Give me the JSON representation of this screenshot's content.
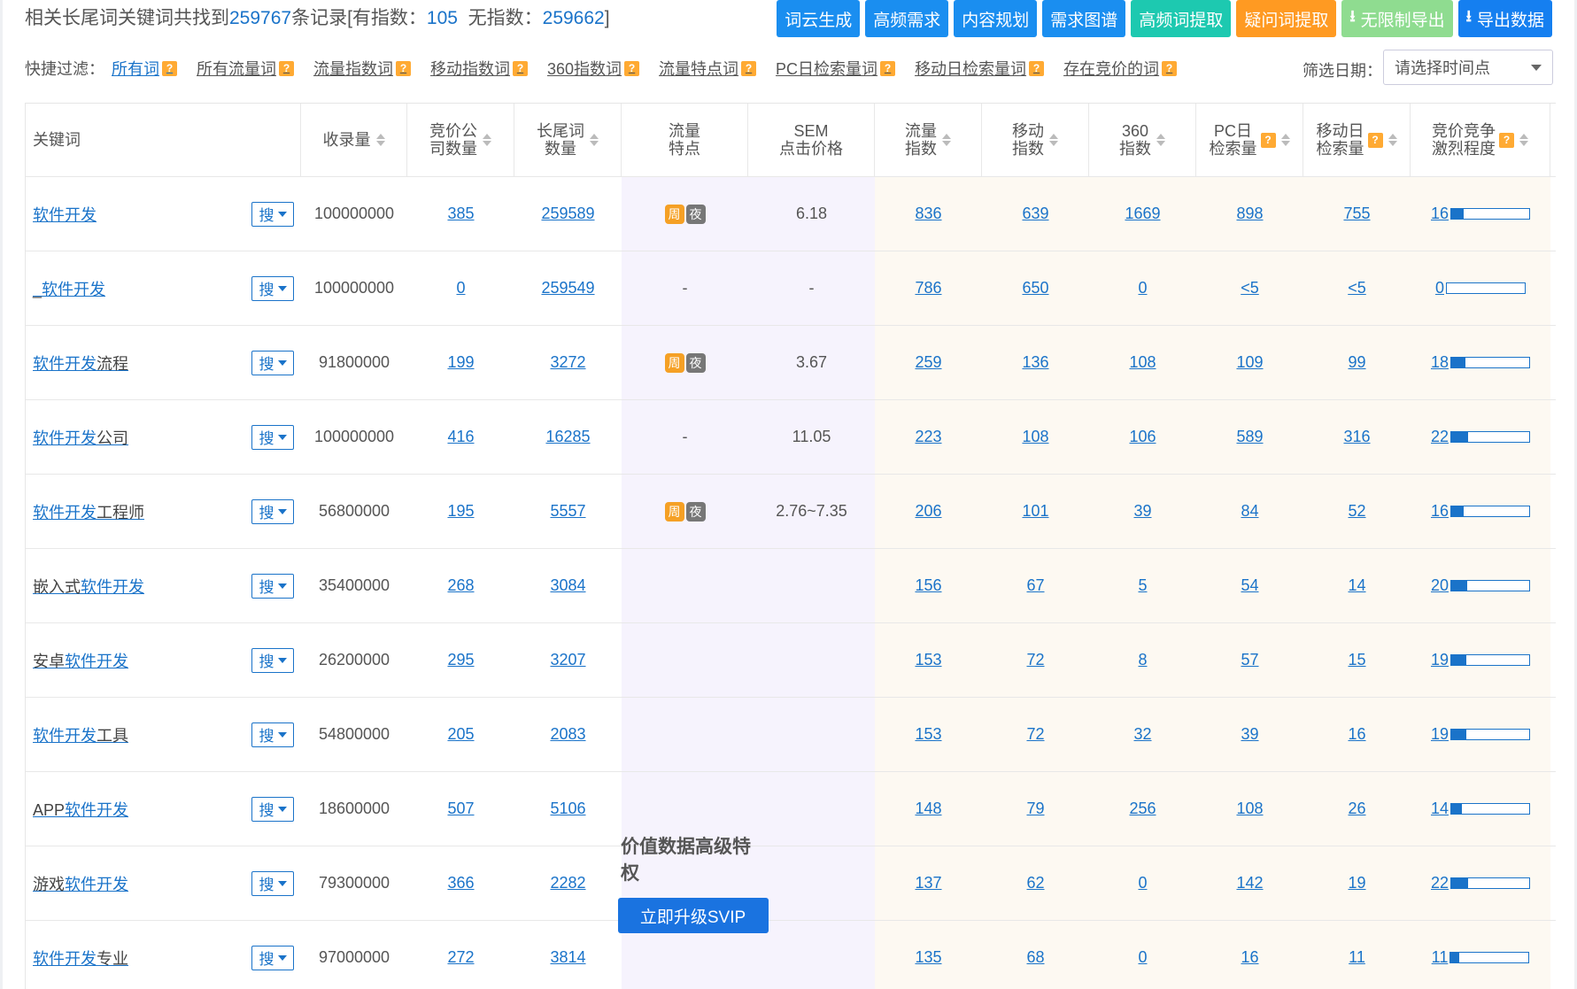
{
  "summary": {
    "prefix": "相关长尾词关键词共找到",
    "total": "259767",
    "mid": "条记录[有指数：",
    "with_index": "105",
    "mid2": "  无指数：",
    "without_index": "259662",
    "suffix": "]"
  },
  "actions": [
    {
      "label": "词云生成",
      "style": "blue"
    },
    {
      "label": "高频需求",
      "style": "blue"
    },
    {
      "label": "内容规划",
      "style": "blue"
    },
    {
      "label": "需求图谱",
      "style": "blue"
    },
    {
      "label": "高频词提取",
      "style": "teal"
    },
    {
      "label": "疑问词提取",
      "style": "orange"
    },
    {
      "label": "无限制导出",
      "style": "lgreen",
      "icon": "download-icon"
    },
    {
      "label": "导出数据",
      "style": "dblue",
      "icon": "download-icon"
    }
  ],
  "filters": {
    "label": "快捷过滤：",
    "items": [
      "所有词",
      "所有流量词",
      "流量指数词",
      "移动指数词",
      "360指数词",
      "流量特点词",
      "PC日检索量词",
      "移动日检索量词",
      "存在竞价的词"
    ],
    "active_index": 0,
    "help_glyph": "?"
  },
  "date_filter": {
    "label": "筛选日期：",
    "placeholder": "请选择时间点"
  },
  "table": {
    "headers": {
      "keyword": "关键词",
      "shoulu": "收录量",
      "bid_companies": [
        "竞价公",
        "司数量"
      ],
      "longtail": [
        "长尾词",
        "数量"
      ],
      "traffic_feature": [
        "流量",
        "特点"
      ],
      "sem": [
        "SEM",
        "点击价格"
      ],
      "traffic_index": [
        "流量",
        "指数"
      ],
      "mobile_index": [
        "移动",
        "指数"
      ],
      "index360": [
        "360",
        "指数"
      ],
      "pc_daily": [
        "PC日",
        "检索量"
      ],
      "mobile_daily": [
        "移动日",
        "检索量"
      ],
      "competition": [
        "竞价竞争",
        "激烈程度"
      ]
    },
    "search_btn": "搜",
    "tag_week": "周",
    "tag_night": "夜",
    "rows": [
      {
        "pre": "",
        "kw": "软件开发",
        "post": "",
        "shoulu": "100000000",
        "bid": "385",
        "lt": "259589",
        "feat": true,
        "feat_text": "",
        "sem": "6.18",
        "ti": "836",
        "mi": "639",
        "i360": "1669",
        "pc": "898",
        "md": "755",
        "comp": "16",
        "comp_pct": 0.16
      },
      {
        "pre": "_",
        "kw": "软件开发",
        "post": "",
        "shoulu": "100000000",
        "bid": "0",
        "lt": "259549",
        "feat": false,
        "feat_text": "-",
        "sem": "-",
        "ti": "786",
        "mi": "650",
        "i360": "0",
        "pc": "<5",
        "md": "<5",
        "comp": "0",
        "comp_pct": 0.0
      },
      {
        "pre": "",
        "kw": "软件开发",
        "post": "流程",
        "shoulu": "91800000",
        "bid": "199",
        "lt": "3272",
        "feat": true,
        "feat_text": "",
        "sem": "3.67",
        "ti": "259",
        "mi": "136",
        "i360": "108",
        "pc": "109",
        "md": "99",
        "comp": "18",
        "comp_pct": 0.18
      },
      {
        "pre": "",
        "kw": "软件开发",
        "post": "公司",
        "shoulu": "100000000",
        "bid": "416",
        "lt": "16285",
        "feat": false,
        "feat_text": "-",
        "sem": "11.05",
        "ti": "223",
        "mi": "108",
        "i360": "106",
        "pc": "589",
        "md": "316",
        "comp": "22",
        "comp_pct": 0.22
      },
      {
        "pre": "",
        "kw": "软件开发",
        "post": "工程师",
        "shoulu": "56800000",
        "bid": "195",
        "lt": "5557",
        "feat": true,
        "feat_text": "",
        "sem": "2.76~7.35",
        "ti": "206",
        "mi": "101",
        "i360": "39",
        "pc": "84",
        "md": "52",
        "comp": "16",
        "comp_pct": 0.16
      },
      {
        "pre": "嵌入式",
        "kw": "软件开发",
        "post": "",
        "shoulu": "35400000",
        "bid": "268",
        "lt": "3084",
        "feat": false,
        "feat_text": "",
        "sem": "",
        "ti": "156",
        "mi": "67",
        "i360": "5",
        "pc": "54",
        "md": "14",
        "comp": "20",
        "comp_pct": 0.2
      },
      {
        "pre": "安卓",
        "kw": "软件开发",
        "post": "",
        "shoulu": "26200000",
        "bid": "295",
        "lt": "3207",
        "feat": false,
        "feat_text": "",
        "sem": "",
        "ti": "153",
        "mi": "72",
        "i360": "8",
        "pc": "57",
        "md": "15",
        "comp": "19",
        "comp_pct": 0.19
      },
      {
        "pre": "",
        "kw": "软件开发",
        "post": "工具",
        "shoulu": "54800000",
        "bid": "205",
        "lt": "2083",
        "feat": false,
        "feat_text": "",
        "sem": "",
        "ti": "153",
        "mi": "72",
        "i360": "32",
        "pc": "39",
        "md": "16",
        "comp": "19",
        "comp_pct": 0.19
      },
      {
        "pre": "APP",
        "kw": "软件开发",
        "post": "",
        "shoulu": "18600000",
        "bid": "507",
        "lt": "5106",
        "feat": false,
        "feat_text": "",
        "sem": "",
        "ti": "148",
        "mi": "79",
        "i360": "256",
        "pc": "108",
        "md": "26",
        "comp": "14",
        "comp_pct": 0.14
      },
      {
        "pre": "游戏",
        "kw": "软件开发",
        "post": "",
        "shoulu": "79300000",
        "bid": "366",
        "lt": "2282",
        "feat": false,
        "feat_text": "",
        "sem": "",
        "ti": "137",
        "mi": "62",
        "i360": "0",
        "pc": "142",
        "md": "19",
        "comp": "22",
        "comp_pct": 0.22
      },
      {
        "pre": "",
        "kw": "软件开发",
        "post": "专业",
        "shoulu": "97000000",
        "bid": "272",
        "lt": "3814",
        "feat": false,
        "feat_text": "",
        "sem": "",
        "ti": "135",
        "mi": "68",
        "i360": "0",
        "pc": "16",
        "md": "11",
        "comp": "11",
        "comp_pct": 0.11
      }
    ]
  },
  "upgrade": {
    "title": "价值数据高级特权",
    "button": "立即升级SVIP"
  },
  "colors": {
    "link": "#1a73c9",
    "primary": "#1a8ef0",
    "teal": "#1dc9b0",
    "orange": "#ff9a22",
    "light_green": "#8fdc90",
    "tag_week": "#f5a025",
    "tag_night": "#777777"
  }
}
